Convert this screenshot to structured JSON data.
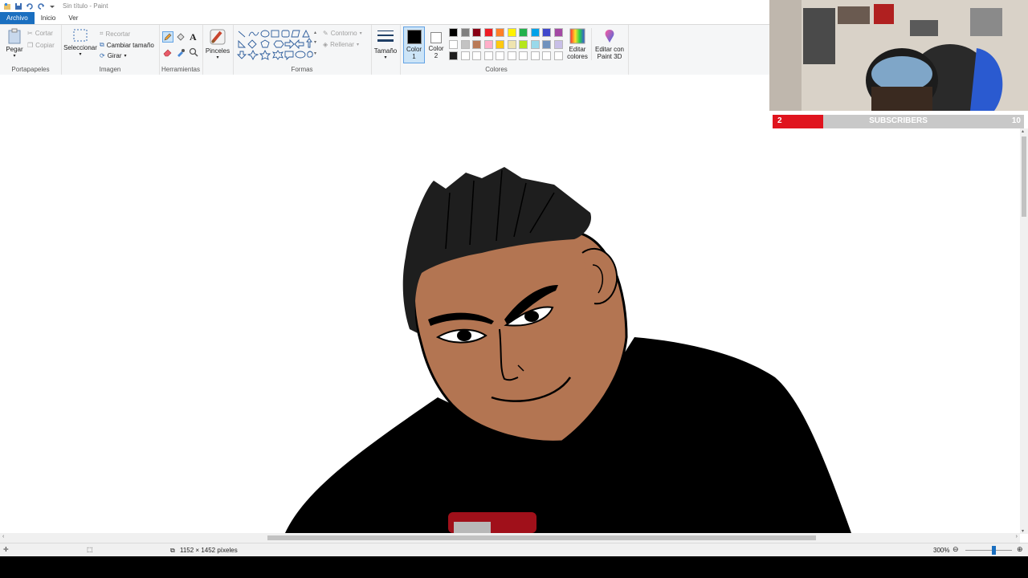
{
  "window": {
    "title": "Sin título - Paint"
  },
  "tabs": [
    {
      "label": "Archivo"
    },
    {
      "label": "Inicio"
    },
    {
      "label": "Ver"
    }
  ],
  "ribbon": {
    "clipboard": {
      "paste": "Pegar",
      "cut": "Cortar",
      "copy": "Copiar",
      "label": "Portapapeles"
    },
    "image": {
      "select": "Seleccionar",
      "crop": "Recortar",
      "resize": "Cambiar tamaño",
      "rotate": "Girar",
      "label": "Imagen"
    },
    "tools": {
      "label": "Herramientas"
    },
    "brushes": {
      "label": "Pinceles"
    },
    "shapes": {
      "outline": "Contorno",
      "fill": "Rellenar",
      "label": "Formas"
    },
    "size": {
      "label": "Tamaño"
    },
    "colors": {
      "color1_line1": "Color",
      "color1_line2": "1",
      "color2_line1": "Color",
      "color2_line2": "2",
      "edit_line1": "Editar",
      "edit_line2": "colores",
      "paint3d_line1": "Editar con",
      "paint3d_line2": "Paint 3D",
      "label": "Colores",
      "color1": "#000000",
      "color2": "#ffffff",
      "palette_row1": [
        "#000000",
        "#7f7f7f",
        "#880015",
        "#ed1c24",
        "#ff7f27",
        "#fff200",
        "#22b14c",
        "#00a2e8",
        "#3f48cc",
        "#a349a4"
      ],
      "palette_row2": [
        "#ffffff",
        "#c3c3c3",
        "#b97a57",
        "#ffaec9",
        "#ffc90e",
        "#efe4b0",
        "#b5e61d",
        "#99d9ea",
        "#7092be",
        "#c8bfe7"
      ],
      "palette_row3": [
        "#1e1e1e",
        "#ffffff",
        "#ffffff",
        "#ffffff",
        "#ffffff",
        "#ffffff",
        "#ffffff",
        "#ffffff",
        "#ffffff",
        "#ffffff"
      ]
    }
  },
  "overlay": {
    "sub_count": "2",
    "sub_label": "SUBSCRIBERS",
    "sub_goal": "10",
    "sub_progress": 0.2
  },
  "status": {
    "dimensions": "1152 × 1452 píxeles",
    "zoom": "300%"
  }
}
